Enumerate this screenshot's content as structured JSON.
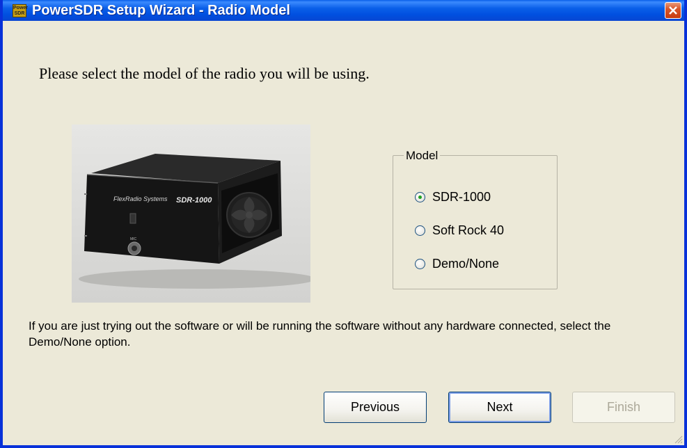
{
  "window": {
    "title": "PowerSDR Setup Wizard - Radio Model",
    "app_icon_text": "Power SDR"
  },
  "heading": "Please select the model of the radio you will be using.",
  "photo": {
    "label": "SDR-1000",
    "brand": "FlexRadio Systems"
  },
  "model_group": {
    "legend": "Model",
    "options": [
      {
        "label": "SDR-1000",
        "checked": true
      },
      {
        "label": "Soft Rock 40",
        "checked": false
      },
      {
        "label": "Demo/None",
        "checked": false
      }
    ]
  },
  "info_text": "If you are just trying out the software or will be running the software without any hardware connected, select the Demo/None option.",
  "buttons": {
    "previous": "Previous",
    "next": "Next",
    "finish": "Finish"
  },
  "colors": {
    "titlebar": "#0a5fe8",
    "window_bg": "#ece9d8",
    "close_button": "#d8562a",
    "radio_dot": "#21a121"
  }
}
